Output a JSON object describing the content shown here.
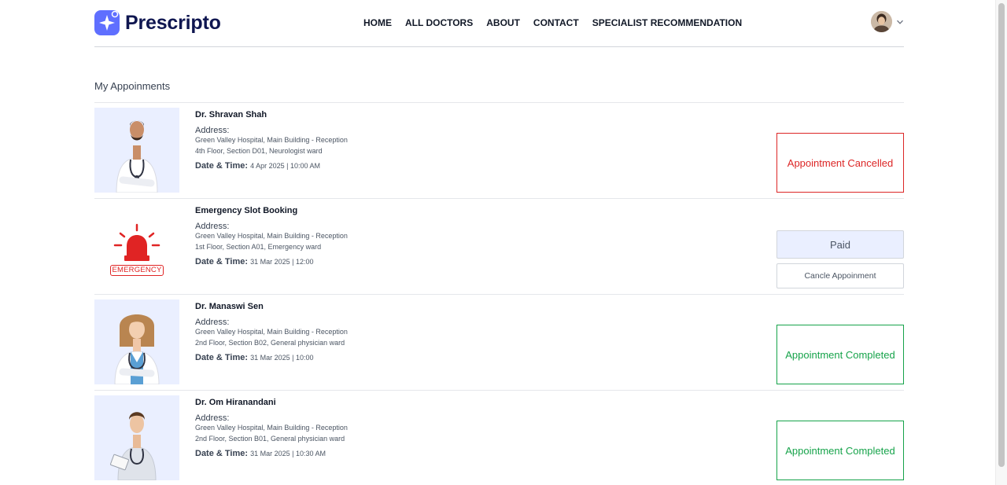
{
  "brand": {
    "name": "Prescripto",
    "color": "#5f6fff"
  },
  "nav": [
    "HOME",
    "ALL DOCTORS",
    "ABOUT",
    "CONTACT",
    "SPECIALIST RECOMMENDATION"
  ],
  "profile": {
    "avatar_icon": "user-avatar",
    "chevron_icon": "chevron-down-icon"
  },
  "section_title": "My Appoinments",
  "appointments": [
    {
      "name": "Dr. Shravan Shah",
      "address_label": "Address:",
      "address_line1": "Green Valley Hospital, Main Building - Reception",
      "address_line2": "4th Floor, Section D01, Neurologist ward",
      "datetime_label": "Date & Time:",
      "datetime": "4 Apr 2025 | 10:00 AM",
      "status": "Appointment Cancelled"
    },
    {
      "name": "Emergency Slot Booking",
      "address_label": "Address:",
      "address_line1": "Green Valley Hospital, Main Building - Reception",
      "address_line2": "1st Floor, Section A01, Emergency ward",
      "datetime_label": "Date & Time:",
      "datetime": "31 Mar 2025 | 12:00",
      "paid_label": "Paid",
      "cancel_label": "Cancle Appoinment",
      "image_text": "EMERGENCY"
    },
    {
      "name": "Dr. Manaswi Sen",
      "address_label": "Address:",
      "address_line1": "Green Valley Hospital, Main Building - Reception",
      "address_line2": "2nd Floor, Section B02, General physician ward",
      "datetime_label": "Date & Time:",
      "datetime": "31 Mar 2025 | 10:00",
      "status": "Appointment Completed"
    },
    {
      "name": "Dr. Om Hiranandani",
      "address_label": "Address:",
      "address_line1": "Green Valley Hospital, Main Building - Reception",
      "address_line2": "2nd Floor, Section B01, General physician ward",
      "datetime_label": "Date & Time:",
      "datetime": "31 Mar 2025 | 10:30 AM",
      "status": "Appointment Completed"
    }
  ],
  "colors": {
    "cancelled": "#dc2626",
    "completed": "#16a34a",
    "paid_bg": "#eaefff",
    "emergency": "#e02424"
  }
}
